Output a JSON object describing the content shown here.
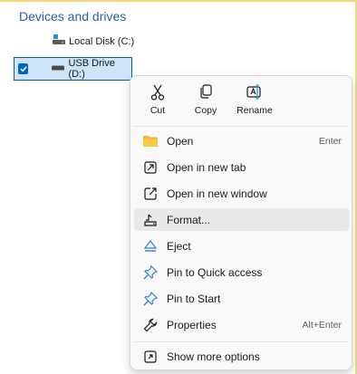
{
  "explorer": {
    "section_title": "Devices and drives",
    "drives": [
      {
        "label": "Local Disk (C:)"
      },
      {
        "label": "USB Drive (D:)",
        "selected": true
      }
    ]
  },
  "context_menu": {
    "quick_actions": [
      {
        "label": "Cut",
        "icon": "scissors-icon"
      },
      {
        "label": "Copy",
        "icon": "copy-icon"
      },
      {
        "label": "Rename",
        "icon": "rename-icon"
      }
    ],
    "items": [
      {
        "label": "Open",
        "icon": "folder-icon",
        "shortcut": "Enter"
      },
      {
        "label": "Open in new tab",
        "icon": "new-tab-icon",
        "shortcut": ""
      },
      {
        "label": "Open in new window",
        "icon": "new-window-icon",
        "shortcut": ""
      },
      {
        "label": "Format...",
        "icon": "format-drive-icon",
        "shortcut": "",
        "highlighted": true
      },
      {
        "label": "Eject",
        "icon": "eject-icon",
        "shortcut": ""
      },
      {
        "label": "Pin to Quick access",
        "icon": "pin-icon",
        "shortcut": ""
      },
      {
        "label": "Pin to Start",
        "icon": "pin-icon",
        "shortcut": ""
      },
      {
        "label": "Properties",
        "icon": "wrench-icon",
        "shortcut": "Alt+Enter"
      },
      {
        "label": "Show more options",
        "icon": "more-options-icon",
        "shortcut": ""
      }
    ]
  },
  "colors": {
    "accent": "#0067c0",
    "selection_bg": "#cce4f7",
    "section_title": "#2b5fa8",
    "pin_blue": "#3a7bd5"
  }
}
